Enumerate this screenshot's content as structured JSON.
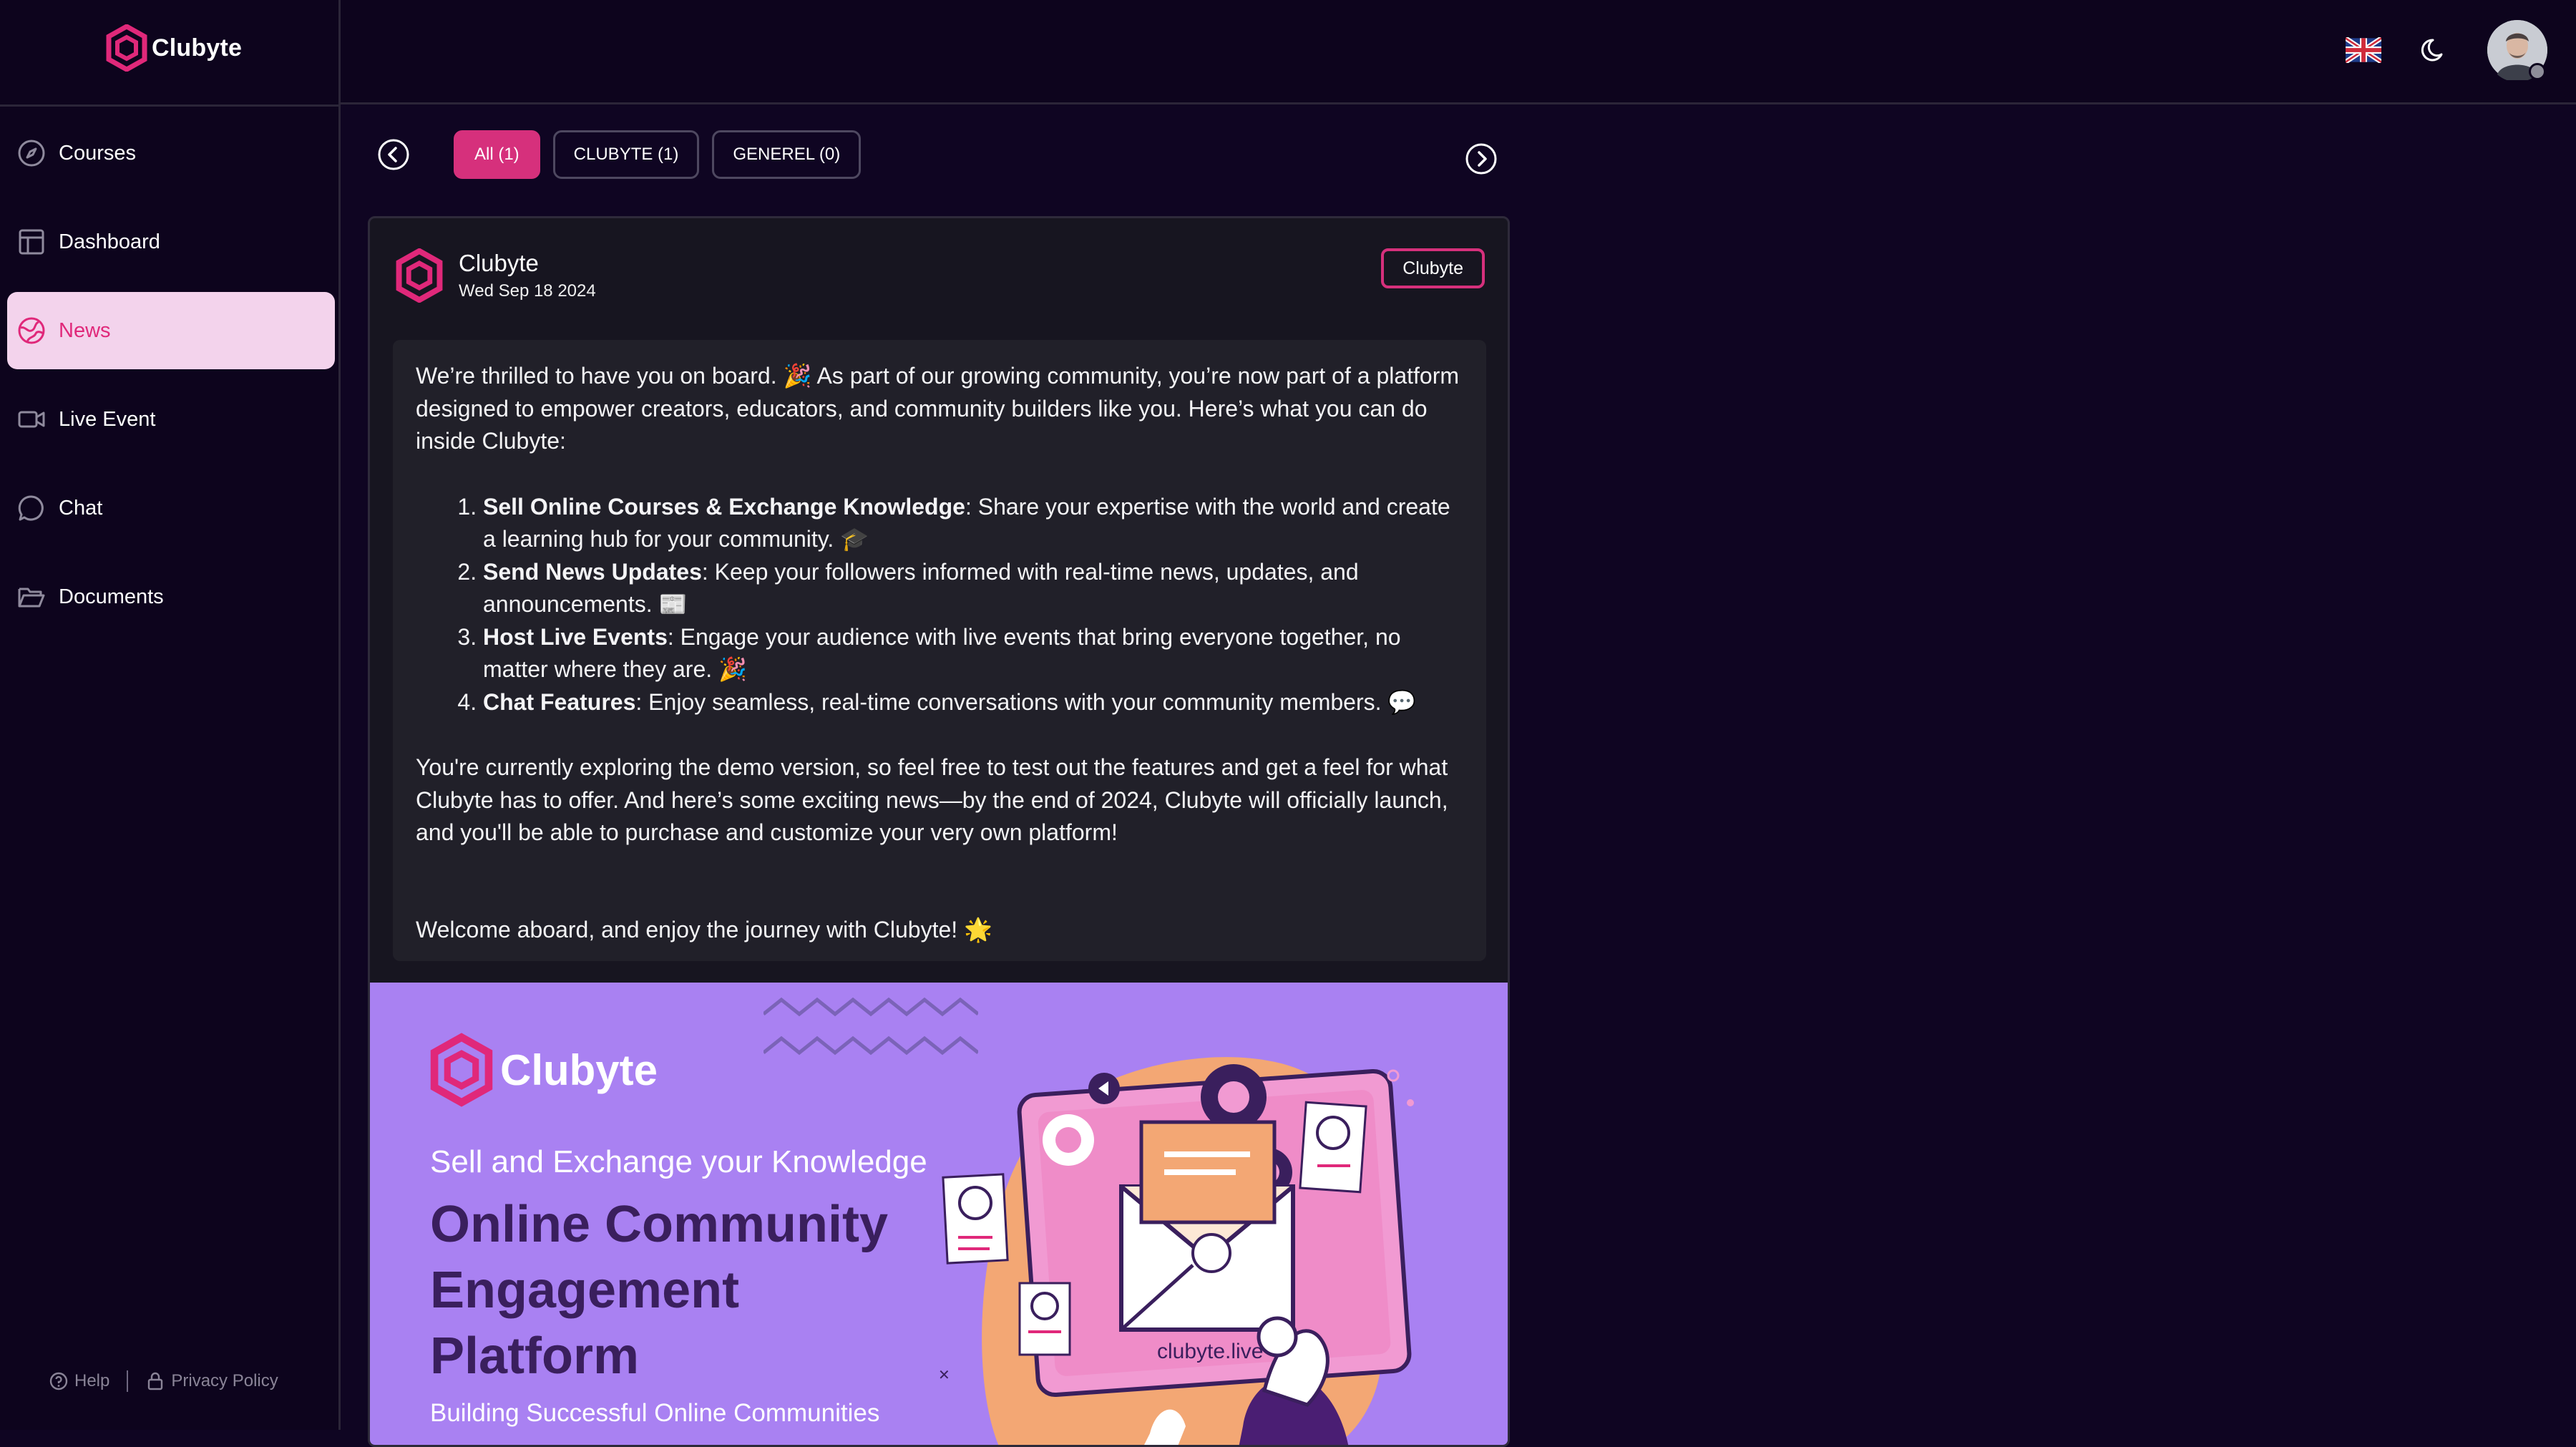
{
  "app": {
    "name": "Clubyte"
  },
  "sidebar": {
    "items": [
      {
        "label": "Courses",
        "icon": "compass-icon"
      },
      {
        "label": "Dashboard",
        "icon": "layout-icon"
      },
      {
        "label": "News",
        "icon": "globe-icon",
        "active": true
      },
      {
        "label": "Live Event",
        "icon": "video-icon"
      },
      {
        "label": "Chat",
        "icon": "chat-bubble-icon"
      },
      {
        "label": "Documents",
        "icon": "folder-icon"
      }
    ],
    "footer": {
      "help": "Help",
      "privacy": "Privacy Policy"
    }
  },
  "header": {
    "language": "English (UK flag)",
    "theme_icon": "moon-icon"
  },
  "filters": {
    "chips": [
      {
        "label": "All (1)",
        "active": true
      },
      {
        "label": "CLUBYTE (1)"
      },
      {
        "label": "GENEREL (0)"
      }
    ]
  },
  "post": {
    "author": "Clubyte",
    "date": "Wed Sep 18 2024",
    "tag": "Clubyte",
    "intro": "We’re thrilled to have you on board. 🎉 As part of our growing community, you’re now part of a platform designed to empower creators, educators, and community builders like you. Here’s what you can do inside Clubyte:",
    "list": [
      {
        "title": "Sell Online Courses & Exchange Knowledge",
        "text": ": Share your expertise with the world and create a learning hub for your community. 🎓"
      },
      {
        "title": "Send News Updates",
        "text": ": Keep your followers informed with real-time news, updates, and announcements. 📰"
      },
      {
        "title": "Host Live Events",
        "text": ": Engage your audience with live events that bring everyone together, no matter where they are. 🎉"
      },
      {
        "title": "Chat Features",
        "text": ": Enjoy seamless, real-time conversations with your community members. 💬"
      }
    ],
    "para2": "You're currently exploring the demo version, so feel free to test out the features and get a feel for what Clubyte has to offer. And here’s some exciting news—by the end of 2024, Clubyte will officially launch, and you'll be able to purchase and customize your very own platform!",
    "closing": "Welcome aboard, and enjoy the journey with Clubyte! 🌟"
  },
  "banner": {
    "logo": "Clubyte",
    "tagline": "Sell and Exchange your Knowledge",
    "title_lines": [
      "Online Community",
      "Engagement",
      "Platform"
    ],
    "subtitle": "Building Successful Online Communities",
    "site": "clubyte.live"
  },
  "colors": {
    "accent": "#d6307c",
    "bg": "#0f0522",
    "banner": "#a981f2"
  }
}
